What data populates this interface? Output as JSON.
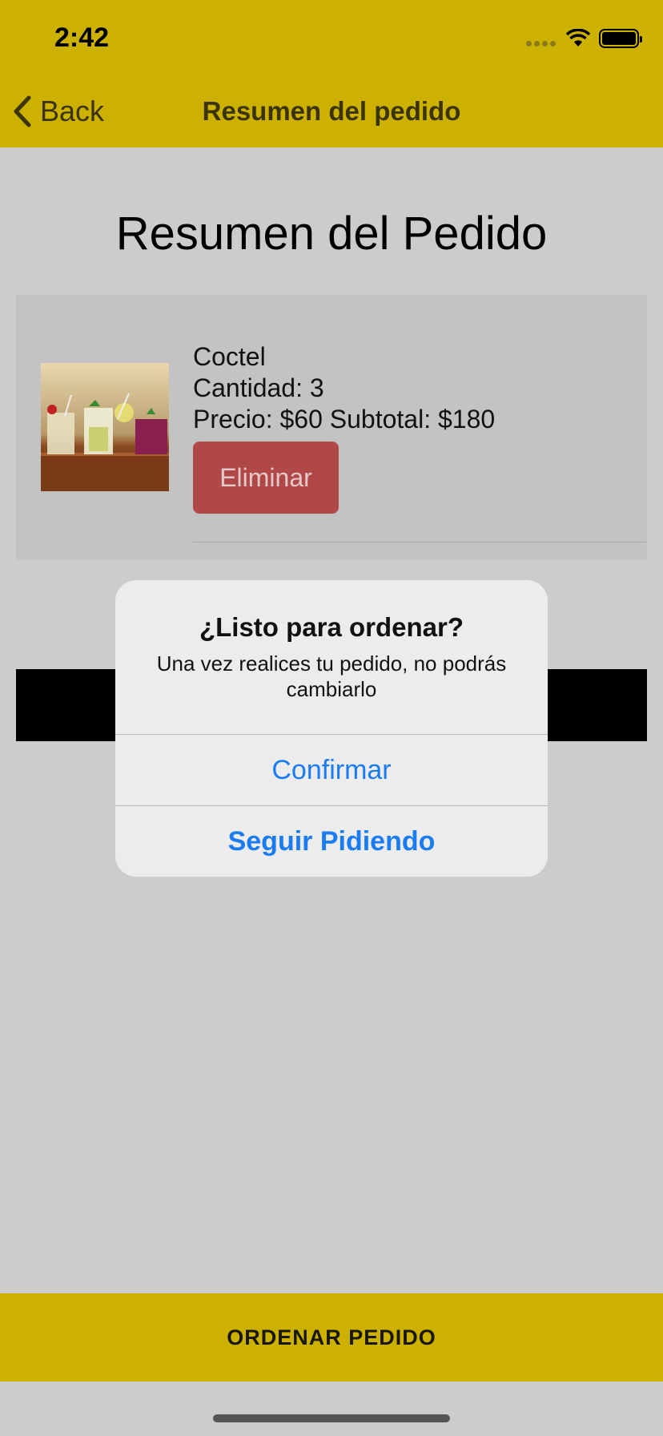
{
  "status_bar": {
    "time": "2:42"
  },
  "nav": {
    "back_label": "Back",
    "title": "Resumen del pedido"
  },
  "page": {
    "title": "Resumen del Pedido"
  },
  "order_item": {
    "name": "Coctel",
    "quantity_line": "Cantidad: 3",
    "price_line": "Precio: $60 Subtotal: $180",
    "delete_label": "Eliminar"
  },
  "alert": {
    "title": "¿Listo para ordenar?",
    "message": "Una vez realices tu pedido, no podrás cambiarlo",
    "confirm_label": "Confirmar",
    "continue_label": "Seguir Pidiendo"
  },
  "bottom_bar": {
    "label": "ORDENAR PEDIDO"
  },
  "colors": {
    "accent_yellow": "#ccb100",
    "delete_red": "#b04848",
    "link_blue": "#1a7cf0"
  }
}
